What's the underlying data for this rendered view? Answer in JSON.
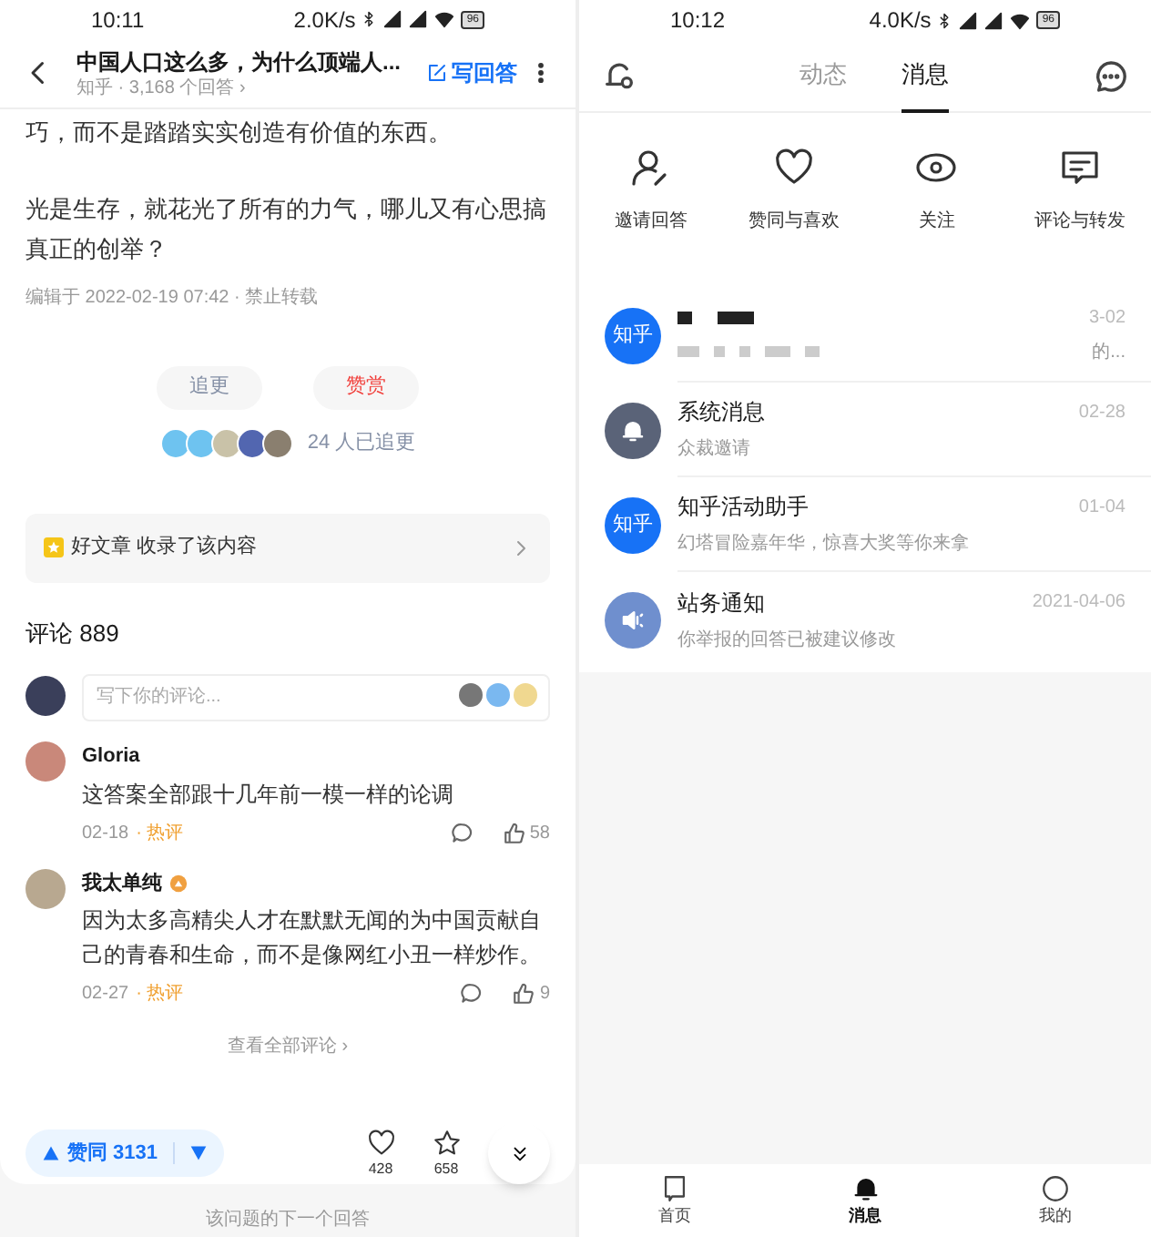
{
  "left": {
    "status_bar": {
      "time": "10:11",
      "speed": "2.0K/s",
      "battery": "96"
    },
    "header": {
      "title": "中国人口这么多，为什么顶端人...",
      "subtitle": "知乎 · 3,168 个回答 ›",
      "write_button": "写回答"
    },
    "paragraphs": [
      "巧，而不是踏踏实实创造有价值的东西。",
      "光是生存，就花光了所有的力气，哪儿又有心思搞真正的创举？"
    ],
    "edit_info": "编辑于 2022-02-19 07:42 · 禁止转载",
    "buttons": [
      {
        "label": "追更",
        "kind": "follow"
      },
      {
        "label": "赞赏",
        "kind": "reward"
      }
    ],
    "followers": "24 人已追更",
    "collection": "好文章 收录了该内容",
    "comments_heading": "评论 889",
    "comment_input": {
      "placeholder": "写下你的评论..."
    },
    "comments": [
      {
        "author": "Gloria",
        "badge": false,
        "text": "这答案全部跟十几年前一模一样的论调",
        "date": "02-18",
        "tag": "· 热评",
        "likes": "58"
      },
      {
        "author": "我太单纯",
        "badge": true,
        "text": "因为太多高精尖人才在默默无闻的为中国贡献自己的青春和生命，而不是像网红小丑一样炒作。",
        "date": "02-27",
        "tag": "· 热评",
        "likes": "9"
      }
    ],
    "view_all": "查看全部评论 ›",
    "vote": "赞同 3131",
    "actions": [
      {
        "kind": "heart",
        "count": "428"
      },
      {
        "kind": "star",
        "count": "658"
      }
    ],
    "next_answer": "该问题的下一个回答"
  },
  "right": {
    "status_bar": {
      "time": "10:12",
      "speed": "4.0K/s",
      "battery": "96"
    },
    "tabs": [
      {
        "label": "动态",
        "selected": false
      },
      {
        "label": "消息",
        "selected": true
      }
    ],
    "shortcuts": [
      {
        "kind": "invite",
        "label": "邀请回答"
      },
      {
        "kind": "heart",
        "label": "赞同与喜欢"
      },
      {
        "kind": "eye",
        "label": "关注"
      },
      {
        "kind": "comment",
        "label": "评论与转发"
      }
    ],
    "messages": [
      {
        "kind": "logo",
        "avatar_text": "知乎",
        "preview": "的...",
        "date": "3-02",
        "redacted": true
      },
      {
        "kind": "bell",
        "title": "系统消息",
        "preview": "众裁邀请",
        "date": "02-28",
        "redacted": false
      },
      {
        "kind": "logo",
        "avatar_text": "知乎",
        "title": "知乎活动助手",
        "preview": "幻塔冒险嘉年华，惊喜大奖等你来拿",
        "date": "01-04",
        "redacted": false
      },
      {
        "kind": "speaker",
        "title": "站务通知",
        "preview": "你举报的回答已被建议修改",
        "date": "2021-04-06",
        "redacted": false
      }
    ],
    "nav": [
      {
        "kind": "home",
        "label": "首页",
        "selected": false
      },
      {
        "kind": "bell",
        "label": "消息",
        "selected": true
      },
      {
        "kind": "profile",
        "label": "我的",
        "selected": false
      }
    ]
  }
}
